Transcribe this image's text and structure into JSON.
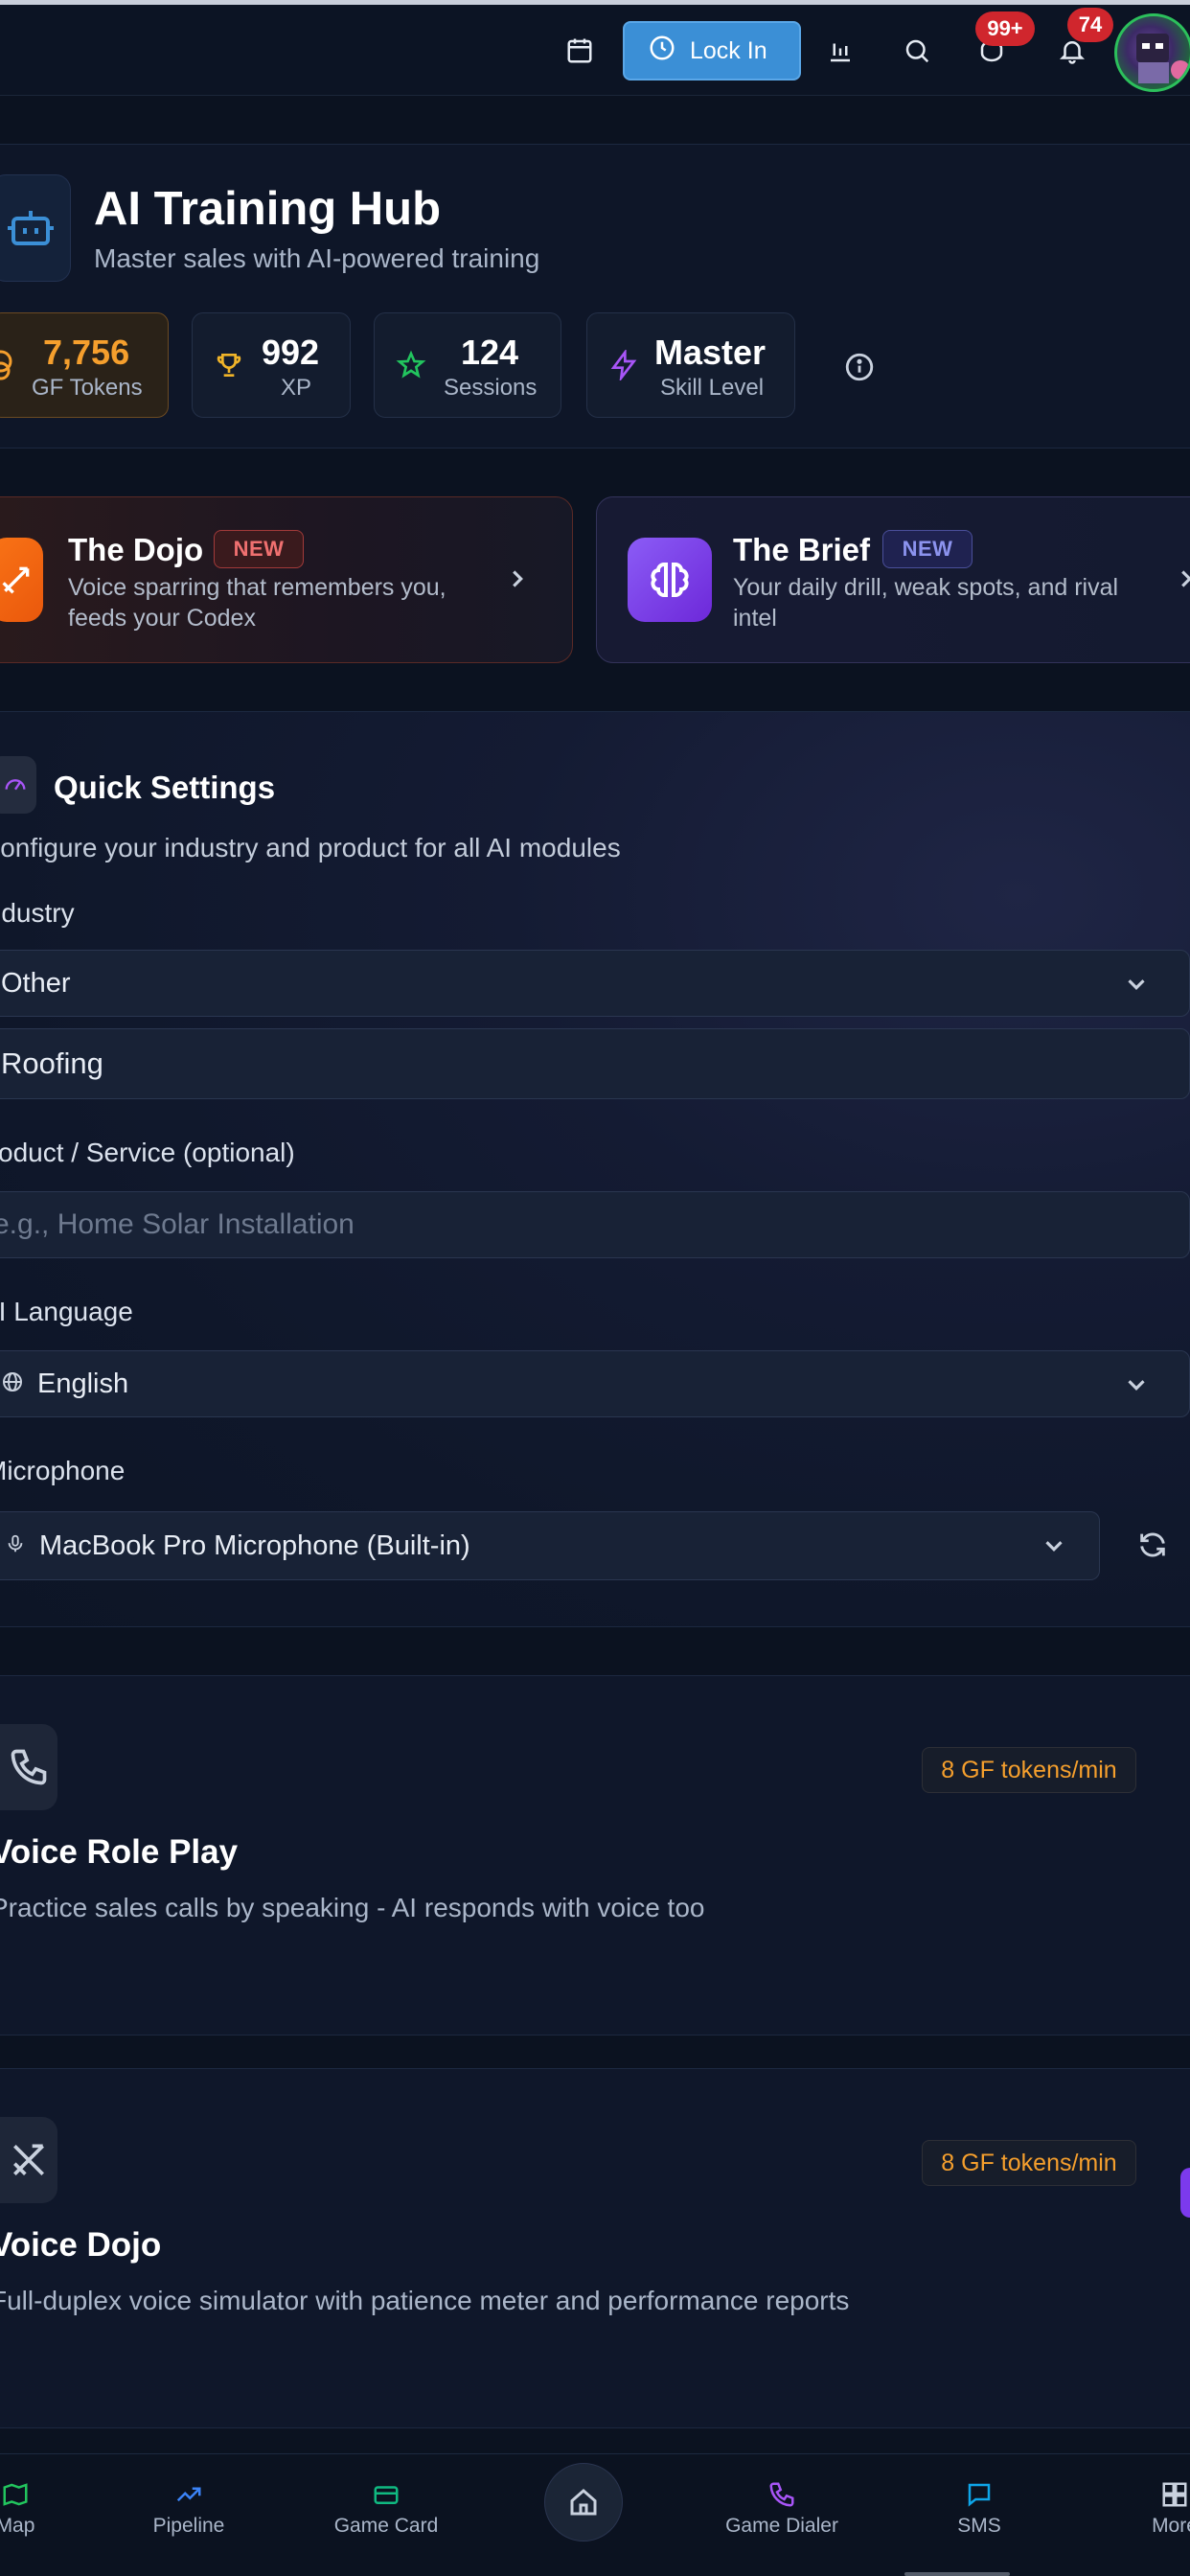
{
  "topbar": {
    "lock_in_label": "Lock In",
    "messages_badge": "99+",
    "notifications_badge": "74"
  },
  "hub": {
    "title": "AI Training Hub",
    "subtitle": "Master sales with AI-powered training",
    "stats": [
      {
        "value": "7,756",
        "label": "GF Tokens",
        "icon": "coins-icon"
      },
      {
        "value": "992",
        "label": "XP",
        "icon": "trophy-icon"
      },
      {
        "value": "124",
        "label": "Sessions",
        "icon": "star-icon"
      },
      {
        "value": "Master",
        "label": "Skill Level",
        "icon": "lightning-icon"
      }
    ]
  },
  "promos": [
    {
      "title": "The Dojo",
      "badge": "NEW",
      "desc_line1": "Voice sparring that remembers you,",
      "desc_line2": "feeds your Codex"
    },
    {
      "title": "The Brief",
      "badge": "NEW",
      "desc_line1": "Your daily drill, weak spots, and rival",
      "desc_line2": "intel"
    }
  ],
  "settings": {
    "title": "Quick Settings",
    "description": "Configure your industry and product for all AI modules",
    "industry_label": "Industry",
    "industry_value": "Other",
    "custom_industry_value": "Roofing",
    "product_label": "Product / Service (optional)",
    "product_placeholder": "e.g., Home Solar Installation",
    "language_label": "AI Language",
    "language_value": "English",
    "microphone_label": "Microphone",
    "microphone_value": "MacBook Pro Microphone (Built-in)"
  },
  "features": [
    {
      "title": "Voice Role Play",
      "desc": "Practice sales calls by speaking - AI responds with voice too",
      "cost": "8 GF tokens/min"
    },
    {
      "title": "Voice Dojo",
      "desc": "Full-duplex voice simulator with patience meter and performance reports",
      "cost": "8 GF tokens/min"
    }
  ],
  "bottom_nav": [
    {
      "label": "Map"
    },
    {
      "label": "Pipeline"
    },
    {
      "label": "Game Card"
    },
    {
      "label": "Game Dialer"
    },
    {
      "label": "SMS"
    },
    {
      "label": "More"
    }
  ],
  "colors": {
    "background": "#0b1220",
    "accent_blue": "#3b8fd6",
    "token_orange": "#f59f2d",
    "badge_red": "#d0262d"
  }
}
